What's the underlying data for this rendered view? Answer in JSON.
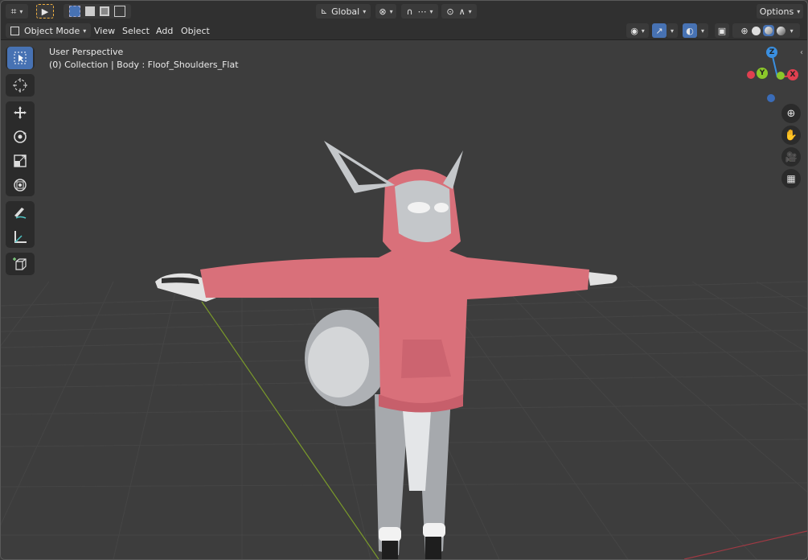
{
  "header": {
    "transform_orientation": "Global",
    "options_label": "Options",
    "mode_label": "Object Mode",
    "menus": [
      "View",
      "Select",
      "Add",
      "Object"
    ]
  },
  "viewport": {
    "perspective_label": "User Perspective",
    "collection_label": "(0) Collection | Body : Floof_Shoulders_Flat"
  },
  "gizmo": {
    "z_label": "Z",
    "y_label": "Y",
    "x_label": "X"
  },
  "colors": {
    "accent": "#4772b3",
    "axis_x": "#e04050",
    "axis_y": "#8bc72a",
    "axis_z": "#3a8fe0",
    "hoodie": "#d9707a"
  },
  "icons": {
    "select_tool": "select-box-icon",
    "cursor_tool": "cursor-icon",
    "move_tool": "move-icon",
    "rotate_tool": "rotate-icon",
    "scale_tool": "scale-icon",
    "transform_tool": "transform-icon",
    "annotate_tool": "annotate-icon",
    "measure_tool": "measure-icon",
    "add_cube_tool": "add-cube-icon"
  }
}
